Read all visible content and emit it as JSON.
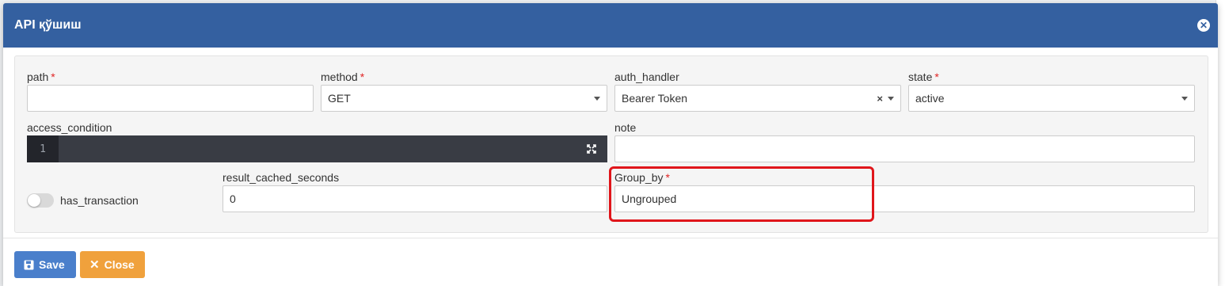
{
  "modal": {
    "title": "API қўшиш"
  },
  "fields": {
    "path": {
      "label": "path",
      "value": ""
    },
    "method": {
      "label": "method",
      "value": "GET"
    },
    "auth_handler": {
      "label": "auth_handler",
      "value": "Bearer Token"
    },
    "state": {
      "label": "state",
      "value": "active"
    },
    "access_condition": {
      "label": "access_condition",
      "line_number": "1"
    },
    "note": {
      "label": "note",
      "value": ""
    },
    "has_transaction": {
      "label": "has_transaction",
      "on": false
    },
    "result_cached_seconds": {
      "label": "result_cached_seconds",
      "value": "0"
    },
    "group_by": {
      "label": "Group_by",
      "value": "Ungrouped"
    }
  },
  "required_marker": "*",
  "buttons": {
    "save": "Save",
    "close": "Close"
  },
  "colors": {
    "header": "#3460a0",
    "save": "#4a7fcb",
    "close": "#f0a13c",
    "highlight": "#e0161b"
  }
}
